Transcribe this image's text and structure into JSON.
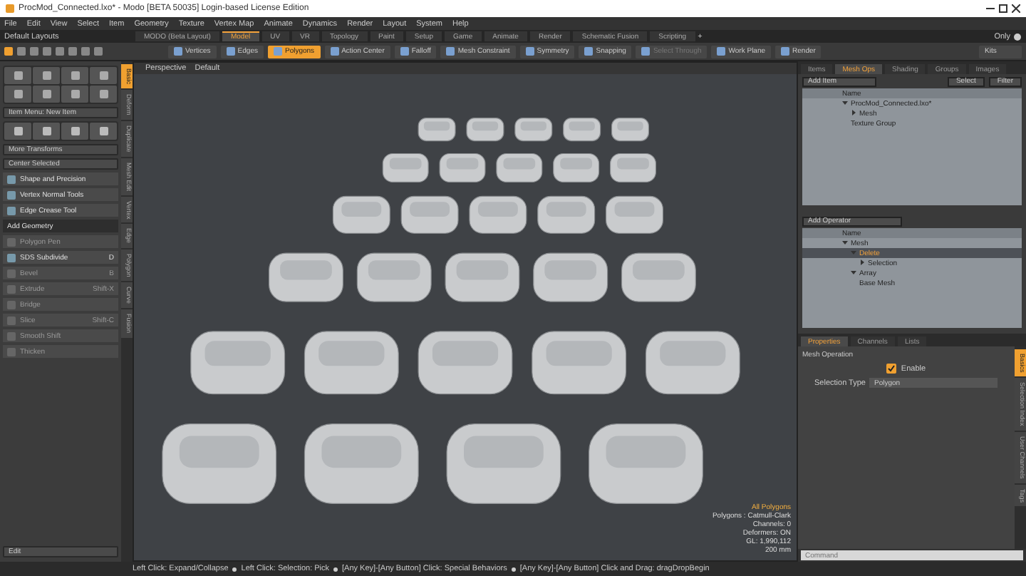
{
  "window": {
    "title": "ProcMod_Connected.lxo* - Modo [BETA 50035] Login-based License Edition"
  },
  "menu": [
    "File",
    "Edit",
    "View",
    "Select",
    "Item",
    "Geometry",
    "Texture",
    "Vertex Map",
    "Animate",
    "Dynamics",
    "Render",
    "Layout",
    "System",
    "Help"
  ],
  "layouts": {
    "dropdown": "Default Layouts",
    "tabs": [
      {
        "label": "MODO (Beta Layout)",
        "selected": false
      },
      {
        "label": "Model",
        "selected": true
      },
      {
        "label": "UV",
        "selected": false
      },
      {
        "label": "VR",
        "selected": false
      },
      {
        "label": "Topology",
        "selected": false
      },
      {
        "label": "Paint",
        "selected": false
      },
      {
        "label": "Setup",
        "selected": false
      },
      {
        "label": "Game",
        "selected": false
      },
      {
        "label": "Animate",
        "selected": false
      },
      {
        "label": "Render",
        "selected": false
      },
      {
        "label": "Schematic Fusion",
        "selected": false
      },
      {
        "label": "Scripting",
        "selected": false
      }
    ],
    "add": "+",
    "only": "Only"
  },
  "toolbar": [
    {
      "label": "Vertices",
      "selected": false,
      "disabled": false
    },
    {
      "label": "Edges",
      "selected": false,
      "disabled": false
    },
    {
      "label": "Polygons",
      "selected": true,
      "disabled": false
    },
    {
      "label": "Action Center",
      "selected": false,
      "disabled": false
    },
    {
      "label": "Falloff",
      "selected": false,
      "disabled": false
    },
    {
      "label": "Mesh Constraint",
      "selected": false,
      "disabled": false
    },
    {
      "label": "Symmetry",
      "selected": false,
      "disabled": false
    },
    {
      "label": "Snapping",
      "selected": false,
      "disabled": false
    },
    {
      "label": "Select Through",
      "selected": false,
      "disabled": true
    },
    {
      "label": "Work Plane",
      "selected": false,
      "disabled": false
    },
    {
      "label": "Render",
      "selected": false,
      "disabled": false
    }
  ],
  "kits": "Kits",
  "left_panel": {
    "item_menu": "Item Menu: New Item",
    "dropdowns": [
      "More Transforms",
      "Center Selected"
    ],
    "tools": [
      {
        "kind": "tool",
        "label": "Shape and Precision",
        "disabled": false
      },
      {
        "kind": "tool",
        "label": "Vertex Normal Tools",
        "disabled": false
      },
      {
        "kind": "tool",
        "label": "Edge Crease Tool",
        "disabled": false
      },
      {
        "kind": "header",
        "label": "Add Geometry",
        "disabled": false
      },
      {
        "kind": "tool",
        "label": "Polygon Pen",
        "disabled": true
      },
      {
        "kind": "tool",
        "label": "SDS Subdivide",
        "shortcut": "D",
        "disabled": false
      },
      {
        "kind": "tool",
        "label": "Bevel",
        "shortcut": "B",
        "disabled": true
      },
      {
        "kind": "tool",
        "label": "Extrude",
        "shortcut": "Shift-X",
        "disabled": true
      },
      {
        "kind": "tool",
        "label": "Bridge",
        "disabled": true
      },
      {
        "kind": "tool",
        "label": "Slice",
        "shortcut": "Shift-C",
        "disabled": true
      },
      {
        "kind": "tool",
        "label": "Smooth Shift",
        "disabled": true
      },
      {
        "kind": "tool",
        "label": "Thicken",
        "disabled": true
      }
    ],
    "bottom": "Edit",
    "tabs": [
      {
        "label": "Basic",
        "selected": true
      },
      {
        "label": "Deform",
        "selected": false
      },
      {
        "label": "Duplicate",
        "selected": false
      },
      {
        "label": "Mesh Edit",
        "selected": false
      },
      {
        "label": "Vertex",
        "selected": false
      },
      {
        "label": "Edge",
        "selected": false
      },
      {
        "label": "Polygon",
        "selected": false
      },
      {
        "label": "Curve",
        "selected": false
      },
      {
        "label": "Fusion",
        "selected": false
      }
    ]
  },
  "viewport": {
    "view": "Perspective",
    "style": "Default",
    "hud": [
      {
        "kind": "highlight",
        "text": "All Polygons"
      },
      {
        "kind": "plain",
        "text": "Polygons : Catmull-Clark"
      },
      {
        "kind": "plain",
        "text": "Channels: 0"
      },
      {
        "kind": "plain",
        "text": "Deformers: ON"
      },
      {
        "kind": "plain",
        "text": "GL: 1,990,112"
      },
      {
        "kind": "plain",
        "text": "200 mm"
      }
    ]
  },
  "items_panel": {
    "tabs": [
      {
        "label": "Items",
        "selected": false
      },
      {
        "label": "Mesh Ops",
        "selected": true
      },
      {
        "label": "Shading",
        "selected": false
      },
      {
        "label": "Groups",
        "selected": false
      },
      {
        "label": "Images",
        "selected": false
      }
    ],
    "add_item": "Add Item",
    "buttons": [
      "Select",
      "Filter"
    ],
    "column": "Name",
    "tree": [
      {
        "label": "ProcMod_Connected.lxo*",
        "selected": false,
        "expanded": true,
        "children": [
          {
            "label": "Mesh",
            "selected": false,
            "expanded": false
          },
          {
            "label": "Texture Group",
            "selected": false
          }
        ]
      }
    ]
  },
  "operators_panel": {
    "add_operator": "Add Operator",
    "column": "Name",
    "tree": [
      {
        "label": "Mesh",
        "selected": false,
        "expanded": true,
        "children": [
          {
            "label": "Delete",
            "selected": true,
            "expanded": true,
            "children": [
              {
                "label": "Selection",
                "selected": false,
                "expanded": false
              }
            ]
          },
          {
            "label": "Array",
            "selected": false,
            "expanded": true,
            "children": [
              {
                "label": "Base Mesh",
                "selected": false
              }
            ]
          }
        ]
      }
    ]
  },
  "properties": {
    "tabs": [
      {
        "label": "Properties",
        "selected": true
      },
      {
        "label": "Channels",
        "selected": false
      },
      {
        "label": "Lists",
        "selected": false
      }
    ],
    "section": "Mesh Operation",
    "enable": {
      "label": "Enable",
      "checked": true
    },
    "selection_type": {
      "label": "Selection Type",
      "value": "Polygon"
    },
    "side_tabs": [
      {
        "label": "Basics",
        "selected": true
      },
      {
        "label": "Selection Index",
        "selected": false
      },
      {
        "label": "User Channels",
        "selected": false
      },
      {
        "label": "Tags",
        "selected": false
      }
    ]
  },
  "command": {
    "placeholder": "Command"
  },
  "status_bar": [
    "Left Click: Expand/Collapse",
    "Left Click: Selection: Pick",
    "[Any Key]-[Any Button] Click: Special Behaviors",
    "[Any Key]-[Any Button] Click and Drag: dragDropBegin"
  ]
}
